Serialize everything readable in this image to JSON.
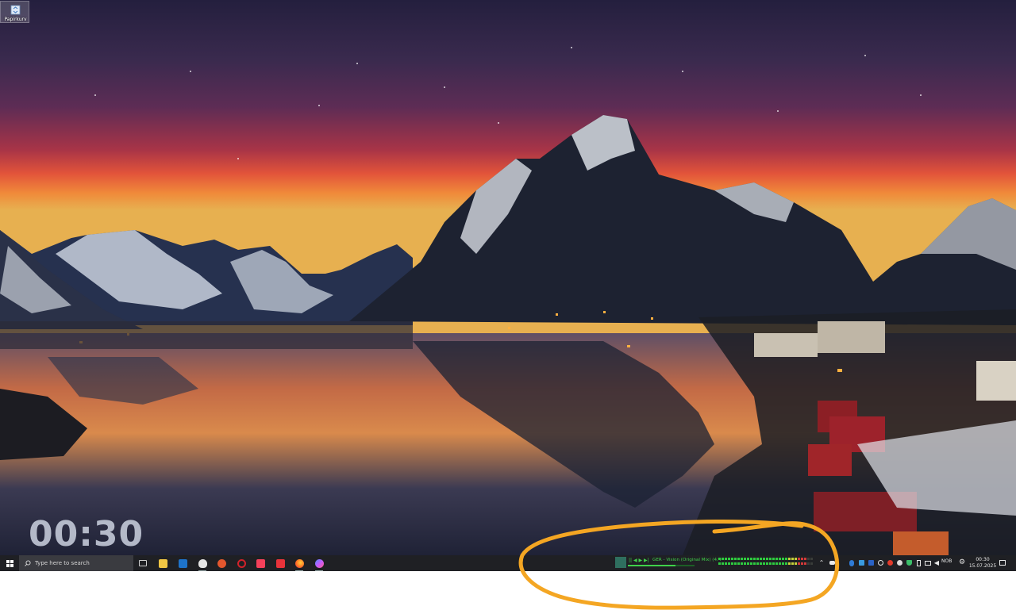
{
  "desktop": {
    "icons": [
      {
        "label": "Papirkurv",
        "icon": "recycle-bin-icon"
      }
    ],
    "clock_widget": "00:30"
  },
  "taskbar": {
    "start_icon": "windows-start-icon",
    "search_placeholder": "Type here to search",
    "apps": [
      {
        "name": "task-view",
        "icon": "task-view-icon",
        "color": "#cfcfcf"
      },
      {
        "name": "file-explorer",
        "icon": "folder-icon",
        "color": "#f2c744"
      },
      {
        "name": "outlook",
        "icon": "outlook-icon",
        "color": "#1e73c9"
      },
      {
        "name": "alienware",
        "icon": "alien-icon",
        "color": "#e6e6e6"
      },
      {
        "name": "app-orange",
        "icon": "orange-circle-icon",
        "color": "#e4572e"
      },
      {
        "name": "opera",
        "icon": "opera-icon",
        "color": "#d3222a"
      },
      {
        "name": "music",
        "icon": "music-icon",
        "color": "#f5415a"
      },
      {
        "name": "wps",
        "icon": "wps-office-icon",
        "color": "#e8333a"
      },
      {
        "name": "firefox",
        "icon": "firefox-icon",
        "color": "#ff8a24"
      },
      {
        "name": "app-gradient",
        "icon": "gradient-circle-icon",
        "color": "#7b6cf0"
      }
    ],
    "media": {
      "controls": "|| ◀ ▶ ▶|",
      "track": "GER - Vision (Original Mix) (4:4",
      "progress": 0.72
    },
    "tray": {
      "icons": [
        "bluetooth-icon",
        "app-icon",
        "app-icon",
        "app-icon",
        "app-icon",
        "app-icon",
        "app-icon",
        "shield-icon",
        "app-icon",
        "app-icon",
        "battery-icon",
        "network-icon",
        "volume-icon"
      ],
      "language": "NOB",
      "time": "00:30",
      "date": "15.07.2025"
    }
  }
}
